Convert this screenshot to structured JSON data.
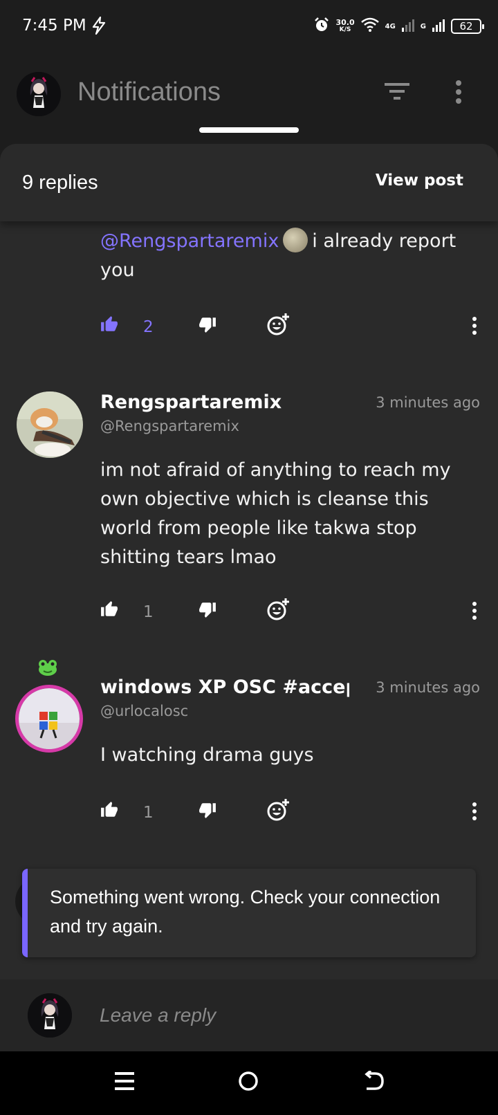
{
  "status_bar": {
    "time": "7:45 PM",
    "net_speed_value": "30.0",
    "net_speed_unit": "K/S",
    "network_1": "4G",
    "network_2": "G",
    "battery": "62"
  },
  "app_bar": {
    "title": "Notifications",
    "icons": [
      "avatar",
      "filter-icon",
      "more-vert-icon"
    ]
  },
  "sheet": {
    "replies_label": "9 replies",
    "view_post_label": "View post"
  },
  "comments": [
    {
      "mention": "@Rengspartaremix",
      "text": "i already report you",
      "likes": "2",
      "liked": true
    },
    {
      "name": "Rengspartaremix",
      "handle": "@Rengspartaremix",
      "time": "3 minutes ago",
      "text": "im not afraid of anything to reach my own objective which is cleanse this world from people like takwa stop shitting tears lmao",
      "likes": "1"
    },
    {
      "name": "windows XP OSC #accep",
      "handle": "@urlocalosc",
      "time": "3 minutes ago",
      "text": "I watching drama guys",
      "likes": "1"
    }
  ],
  "toast": {
    "message": "Something went wrong. Check your connection and try again."
  },
  "reply_bar": {
    "placeholder": "Leave a reply"
  },
  "colors": {
    "accent": "#8474ff",
    "background": "#1d1d1d",
    "sheet": "#2a2a2a"
  }
}
